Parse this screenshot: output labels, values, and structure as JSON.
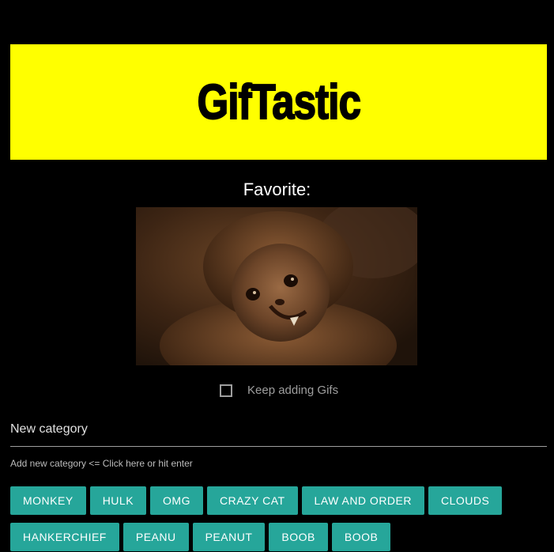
{
  "header": {
    "title": "GifTastic"
  },
  "favorite": {
    "label": "Favorite:"
  },
  "keep_adding": {
    "label": "Keep adding Gifs",
    "checked": false
  },
  "new_category": {
    "label": "New category",
    "value": "",
    "helper": "Add new category <= Click here or hit enter"
  },
  "categories_row1": [
    "MONKEY",
    "HULK",
    "OMG",
    "CRAZY CAT",
    "LAW AND ORDER",
    "CLOUDS"
  ],
  "categories_row2": [
    "HANKERCHIEF",
    "PEANU",
    "PEANUT",
    "BOOB",
    "BOOB"
  ],
  "colors": {
    "background": "#000000",
    "banner": "#ffff00",
    "button": "#26a69a",
    "button_text": "#ffffff"
  }
}
